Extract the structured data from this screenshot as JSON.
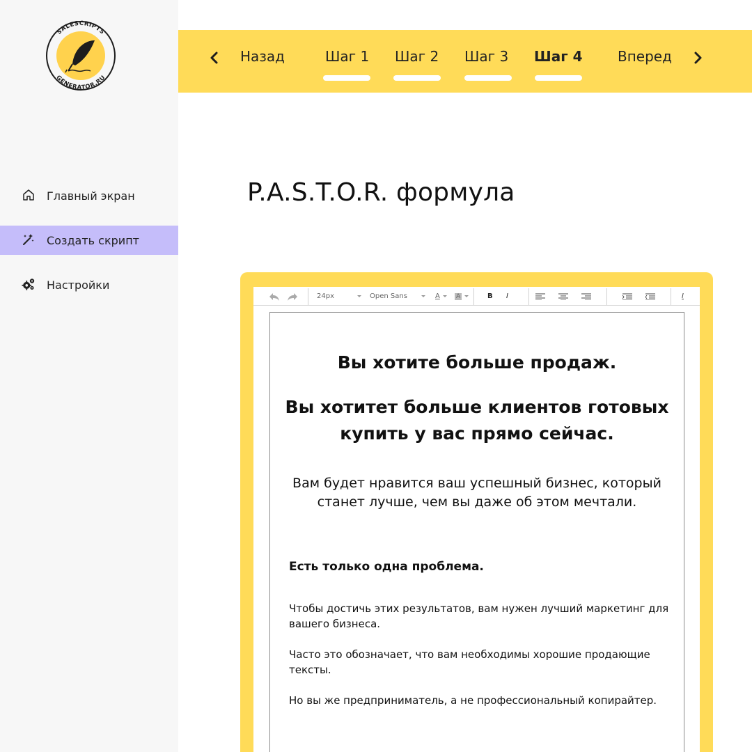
{
  "brand": {
    "logo_text_top": "SALESCRIPTS",
    "logo_text_bottom": "GENERATOR.RU",
    "accent": "#ffdb58",
    "active_nav": "#c5bdfa"
  },
  "sidebar": {
    "items": [
      {
        "label": "Главный экран",
        "icon": "home-icon"
      },
      {
        "label": "Создать скрипт",
        "icon": "magic-wand-icon",
        "active": true
      },
      {
        "label": "Настройки",
        "icon": "gears-icon"
      }
    ]
  },
  "steps": {
    "back": "Назад",
    "forward": "Вперед",
    "items": [
      {
        "label": "Шаг 1"
      },
      {
        "label": "Шаг 2"
      },
      {
        "label": "Шаг 3"
      },
      {
        "label": "Шаг 4",
        "active": true
      }
    ]
  },
  "page": {
    "title": "P.A.S.T.O.R. формула"
  },
  "toolbar": {
    "font_size": "24px",
    "font_family": "Open Sans",
    "font_color_label": "A",
    "bg_color_label": "A",
    "bold_label": "B",
    "italic_label": "I",
    "clear_format_label": "I"
  },
  "document": {
    "headline": "Вы хотите больше продаж.",
    "headline2_line1": "Вы хотитет больше клиентов готовых",
    "headline2_line2": "купить у вас прямо сейчас.",
    "sub_line1": "Вам будет нравится ваш успешный бизнес, который",
    "sub_line2": "станет лучше, чем вы даже об этом мечтали.",
    "problem": "Есть только одна проблема.",
    "para1": "Чтобы достичь этих результатов, вам нужен лучший маркетинг для вашего бизнеса.",
    "para2": "Часто это обозначает, что вам необходимы хорошие продающие тексты.",
    "para3": "Но вы же предприниматель, а не профессиональный копирайтер."
  }
}
